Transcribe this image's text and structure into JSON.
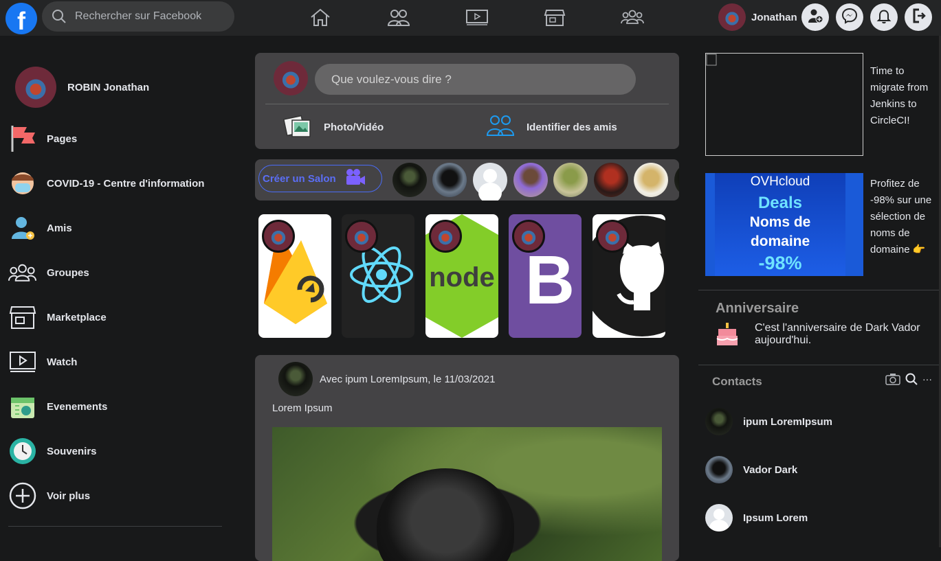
{
  "header": {
    "logo_letter": "f",
    "search_placeholder": "Rechercher sur Facebook",
    "nav": [
      "home-icon",
      "friends-icon",
      "watch-icon",
      "marketplace-icon",
      "groups-icon"
    ],
    "user_name": "Jonathan",
    "actions": [
      "add-friend-icon",
      "messenger-icon",
      "bell-icon",
      "logout-icon"
    ]
  },
  "sidebar": {
    "profile_name": "ROBIN Jonathan",
    "items": [
      {
        "label": "Pages",
        "icon": "flag-icon"
      },
      {
        "label": "COVID-19 - Centre d'information",
        "icon": "mask-icon"
      },
      {
        "label": "Amis",
        "icon": "friends-icon"
      },
      {
        "label": "Groupes",
        "icon": "groups-icon"
      },
      {
        "label": "Marketplace",
        "icon": "shop-icon"
      },
      {
        "label": "Watch",
        "icon": "video-icon"
      },
      {
        "label": "Evenements",
        "icon": "calendar-icon"
      },
      {
        "label": "Souvenirs",
        "icon": "clock-icon"
      },
      {
        "label": "Voir plus",
        "icon": "plus-icon"
      }
    ]
  },
  "composer": {
    "prompt": "Que voulez-vous dire ?",
    "photo_label": "Photo/Vidéo",
    "tag_label": "Identifier des amis"
  },
  "rooms": {
    "create_label": "Créer un Salon"
  },
  "stories": [
    "firebase",
    "react",
    "node",
    "bootstrap",
    "github"
  ],
  "story_node_text": "node",
  "story_bootstrap_text": "B",
  "post": {
    "meta": "Avec ipum LoremIpsum, le 11/03/2021",
    "text": "Lorem Ipsum"
  },
  "ads": [
    {
      "text": "Time to migrate from Jenkins to CircleCI!"
    },
    {
      "text": "Profitez de -98% sur une sélection de noms de domaine 👉",
      "brand": "OVHcloud",
      "line1": "Deals",
      "line2": "Noms de",
      "line3": "domaine",
      "line4": "-98%"
    }
  ],
  "birthday": {
    "title": "Anniversaire",
    "text": "C'est l'anniversaire de Dark Vador aujourd'hui."
  },
  "contacts": {
    "title": "Contacts",
    "list": [
      "ipum LoremIpsum",
      "Vador Dark",
      "Ipsum Lorem"
    ],
    "more": "···"
  },
  "colors": {
    "accent": "#1877f2",
    "background": "#18191a",
    "card": "#444345"
  }
}
